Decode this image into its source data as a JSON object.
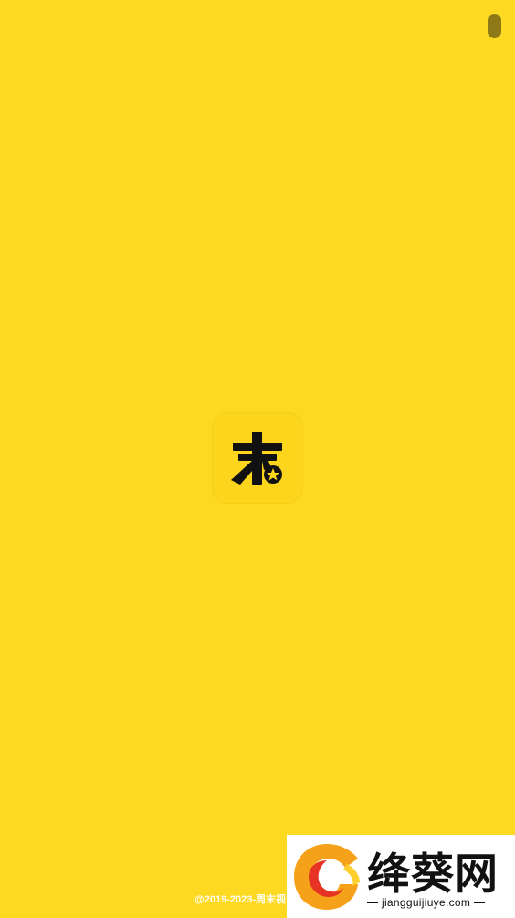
{
  "splash": {
    "background_color": "#fdd922",
    "logo": {
      "icon": "app-logo-icon",
      "glyph": "末",
      "badge_icon": "star-badge-icon"
    },
    "copyright": "@2019-2023-周末视"
  },
  "watermark": {
    "icon": "swirl-logo-icon",
    "name": "绛葵网",
    "domain": "jiangguijiuye.com"
  }
}
